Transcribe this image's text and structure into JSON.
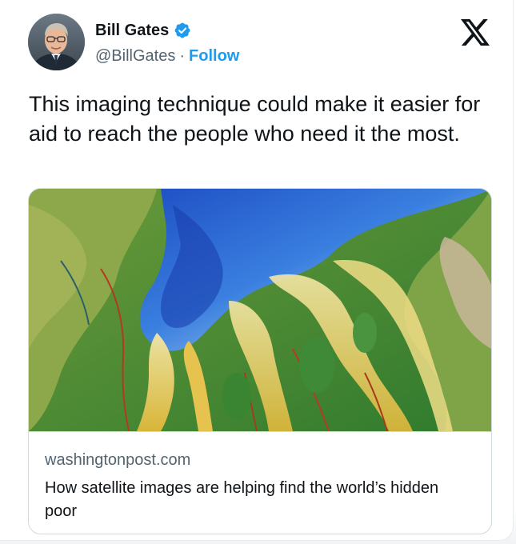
{
  "author": {
    "display_name": "Bill Gates",
    "handle": "@BillGates",
    "separator": "·",
    "follow_label": "Follow",
    "verified": true
  },
  "platform_logo": "x-logo-icon",
  "tweet": {
    "text": "This imaging technique could make it easier for aid to reach the people who need it the most."
  },
  "link_card": {
    "image_description_icon": "satellite-river-delta-image",
    "domain": "washingtonpost.com",
    "title": "How satellite images are helping find the world’s hidden poor"
  },
  "colors": {
    "accent": "#1d9bf0",
    "text_primary": "#0f1419",
    "text_secondary": "#536471",
    "border": "#cfd9de"
  }
}
